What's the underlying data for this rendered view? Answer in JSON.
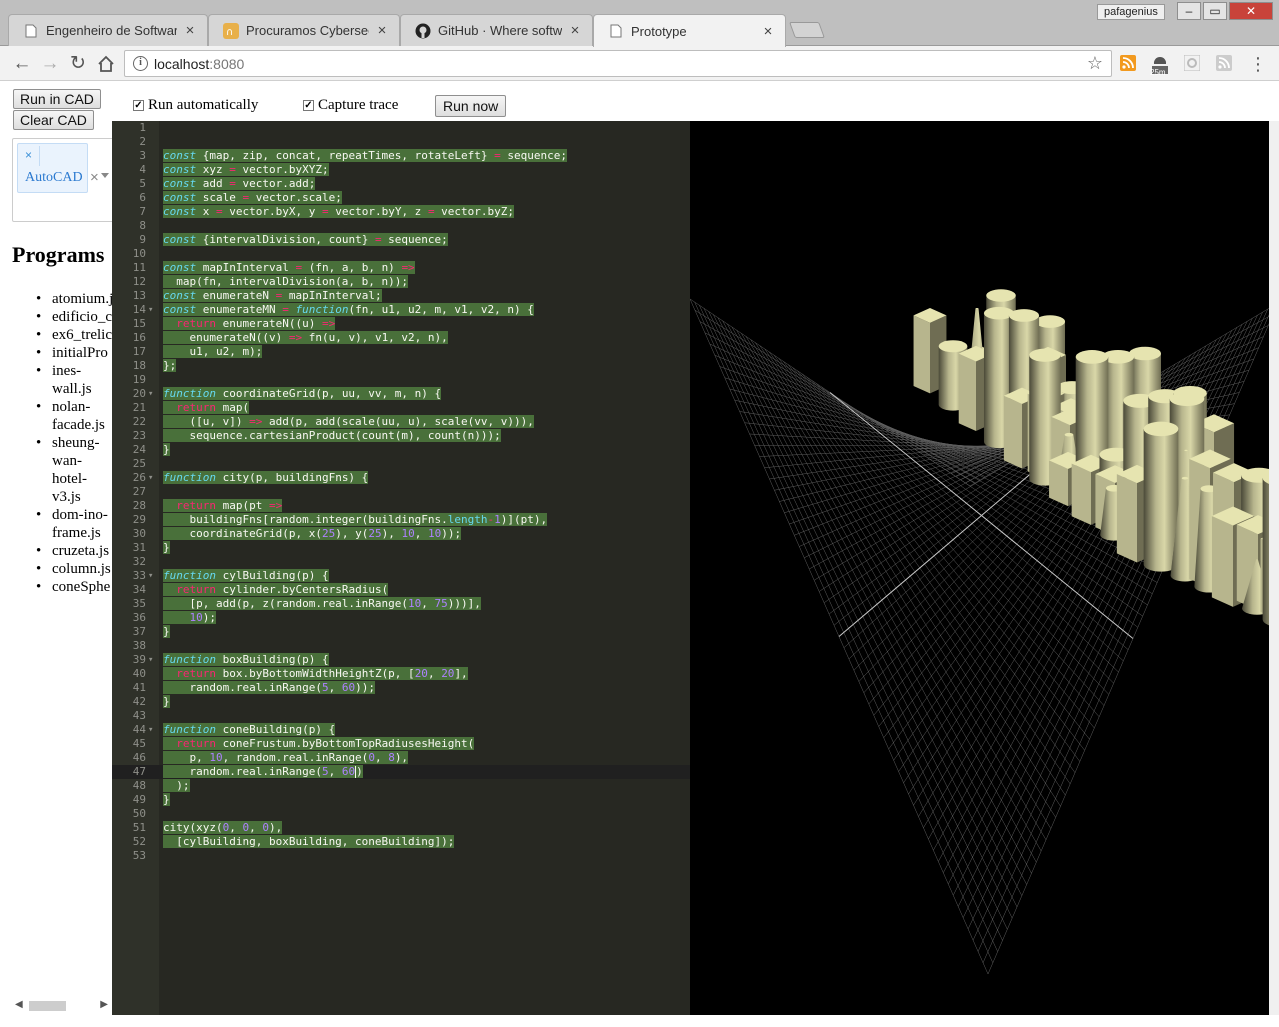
{
  "window": {
    "tabs": [
      {
        "title": "Engenheiro de Software",
        "favicon": "page-icon"
      },
      {
        "title": "Procuramos Cybersecurit",
        "favicon": "pn-logo-icon"
      },
      {
        "title": "GitHub · Where software",
        "favicon": "github-icon"
      },
      {
        "title": "Prototype",
        "favicon": "page-icon"
      }
    ],
    "profile_name": "pafagenius",
    "url_host": "localhost",
    "url_port": ":8080",
    "extension_badge": "25m"
  },
  "cad": {
    "run_label": "Run in CAD",
    "clear_label": "Clear CAD",
    "selected_target": "AutoCAD",
    "remove_glyph": "×"
  },
  "sidebar": {
    "title": "Programs",
    "programs": [
      "atomium.js",
      "edificio_c",
      "ex6_trelic",
      "initialPro",
      "ines-\nwall.js",
      "nolan-\nfacade.js",
      "sheung-\nwan-\nhotel-\nv3.js",
      "dom-ino-\nframe.js",
      "cruzeta.js",
      "column.js",
      "coneSphe"
    ]
  },
  "controls": {
    "run_auto_label": "Run automatically",
    "run_auto_checked": true,
    "capture_trace_label": "Capture trace",
    "capture_trace_checked": true,
    "run_now_label": "Run now"
  },
  "editor": {
    "active_line": 47,
    "lines": [
      "",
      "",
      "const {map, zip, concat, repeatTimes, rotateLeft} = sequence;",
      "const xyz = vector.byXYZ;",
      "const add = vector.add;",
      "const scale = vector.scale;",
      "const x = vector.byX, y = vector.byY, z = vector.byZ;",
      "",
      "const {intervalDivision, count} = sequence;",
      "",
      "const mapInInterval = (fn, a, b, n) =>",
      "  map(fn, intervalDivision(a, b, n));",
      "const enumerateN = mapInInterval;",
      "const enumerateMN = function(fn, u1, u2, m, v1, v2, n) {",
      "  return enumerateN((u) =>",
      "    enumerateN((v) => fn(u, v), v1, v2, n),",
      "    u1, u2, m);",
      "};",
      "",
      "function coordinateGrid(p, uu, vv, m, n) {",
      "  return map(",
      "    ([u, v]) => add(p, add(scale(uu, u), scale(vv, v))),",
      "    sequence.cartesianProduct(count(m), count(n)));",
      "}",
      "",
      "function city(p, buildingFns) {",
      "",
      "  return map(pt =>",
      "    buildingFns[random.integer(buildingFns.length-1)](pt),",
      "    coordinateGrid(p, x(25), y(25), 10, 10));",
      "}",
      "",
      "function cylBuilding(p) {",
      "  return cylinder.byCentersRadius(",
      "    [p, add(p, z(random.real.inRange(10, 75)))],",
      "    10);",
      "}",
      "",
      "function boxBuilding(p) {",
      "  return box.byBottomWidthHeightZ(p, [20, 20],",
      "    random.real.inRange(5, 60));",
      "}",
      "",
      "function coneBuilding(p) {",
      "  return coneFrustum.byBottomTopRadiusesHeight(",
      "    p, 10, random.real.inRange(0, 8),",
      "    random.real.inRange(5, 60)",
      "  );",
      "}",
      "",
      "city(xyz(0, 0, 0),",
      "  [cylBuilding, boxBuilding, coneBuilding]);",
      ""
    ]
  },
  "colors": {
    "editor_bg": "#272822",
    "selection": "#49703a",
    "building": "#e6e4b0",
    "grid": "#6b6b6b"
  }
}
